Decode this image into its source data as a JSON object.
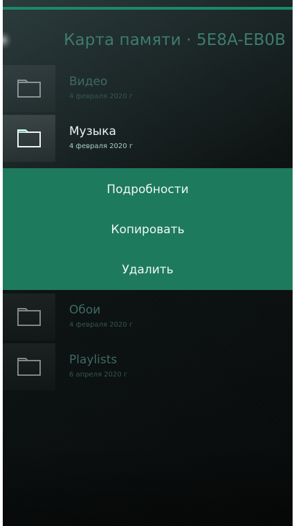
{
  "header": {
    "title": "Карта памяти · 5E8A-EB0B"
  },
  "files": [
    {
      "name": "Видео",
      "date": "4 февраля 2020 г",
      "icon": "folder-icon"
    },
    {
      "name": "Музыка",
      "date": "4 февраля 2020 г",
      "icon": "folder-icon"
    },
    {
      "name": "Обои",
      "date": "4 февраля 2020 г",
      "icon": "folder-icon"
    },
    {
      "name": "Playlists",
      "date": "6 апреля 2020 г",
      "icon": "folder-icon"
    }
  ],
  "context_menu": {
    "items": [
      "Подробности",
      "Копировать",
      "Удалить"
    ]
  },
  "colors": {
    "accent": "#1a8a68",
    "menu_background": "#1e7a5c",
    "title_text": "#3d7d6d",
    "background": "#0c1212"
  }
}
